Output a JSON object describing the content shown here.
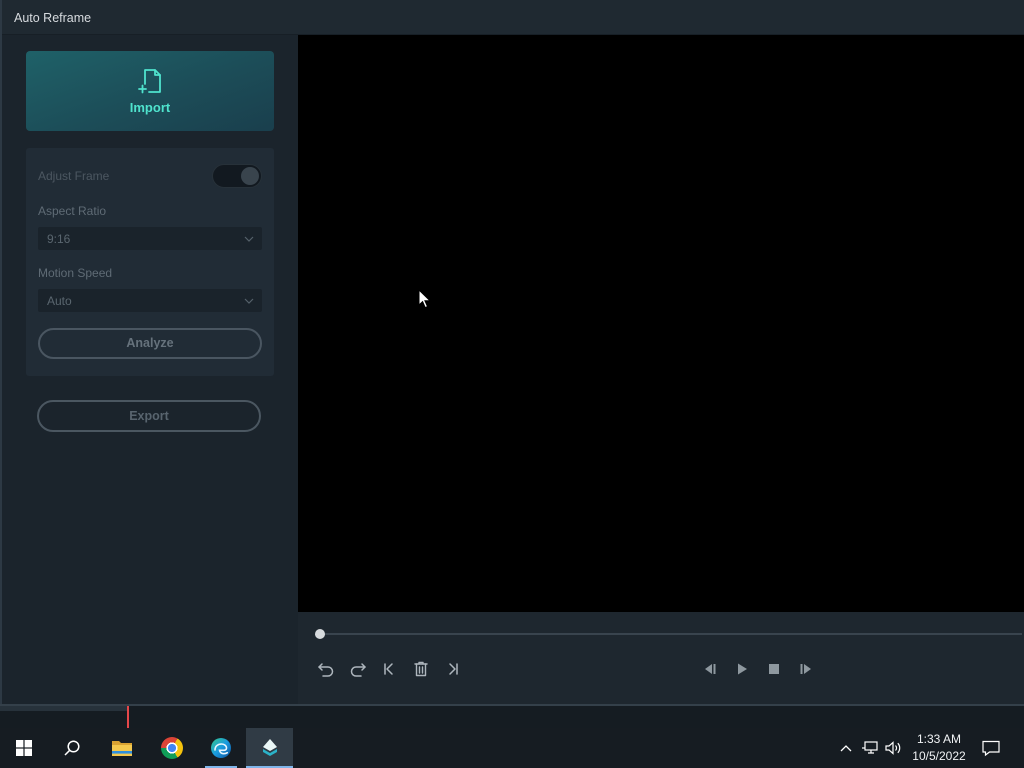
{
  "window": {
    "title": "Auto Reframe"
  },
  "import_card": {
    "label": "Import",
    "icon": "file-import-icon"
  },
  "settings": {
    "disabled": true,
    "adjust_frame": {
      "label": "Adjust Frame",
      "toggle_on": true
    },
    "aspect_ratio": {
      "label": "Aspect Ratio",
      "value": "9:16",
      "icon": "chevron-down-icon"
    },
    "motion_speed": {
      "label": "Motion Speed",
      "value": "Auto",
      "icon": "chevron-down-icon"
    },
    "analyze_button": {
      "label": "Analyze"
    }
  },
  "export_button": {
    "label": "Export"
  },
  "player": {
    "progress": 0,
    "edit_controls": [
      "undo-icon",
      "redo-icon",
      "jump-to-start-icon",
      "delete-icon",
      "jump-to-end-icon"
    ],
    "playback_controls": [
      "previous-frame-icon",
      "play-icon",
      "stop-icon",
      "next-frame-icon"
    ]
  },
  "taskbar": {
    "apps": [
      {
        "icon": "windows-start-icon",
        "running": false,
        "active": false
      },
      {
        "icon": "search-icon",
        "running": false,
        "active": false
      },
      {
        "icon": "file-explorer-icon",
        "running": false,
        "active": false
      },
      {
        "icon": "chrome-icon",
        "running": false,
        "active": false
      },
      {
        "icon": "edge-icon",
        "running": true,
        "active": false
      },
      {
        "icon": "filmora-icon",
        "running": true,
        "active": true
      }
    ],
    "tray_icons": [
      "show-hidden-icons-icon",
      "network-icon",
      "volume-icon"
    ],
    "time": "1:33 AM",
    "date": "10/5/2022",
    "notification_icon": "action-center-icon"
  },
  "colors": {
    "accent": "#4fe3cd",
    "title_bar": "#1f2931",
    "panel": "#1b242c",
    "settings_card": "#212c36",
    "preview": "#000000",
    "player_bar": "#1e272f",
    "taskbar": "#161c22",
    "taskbar_indicator": "#7fb5ea",
    "playhead": "#e5474a"
  }
}
